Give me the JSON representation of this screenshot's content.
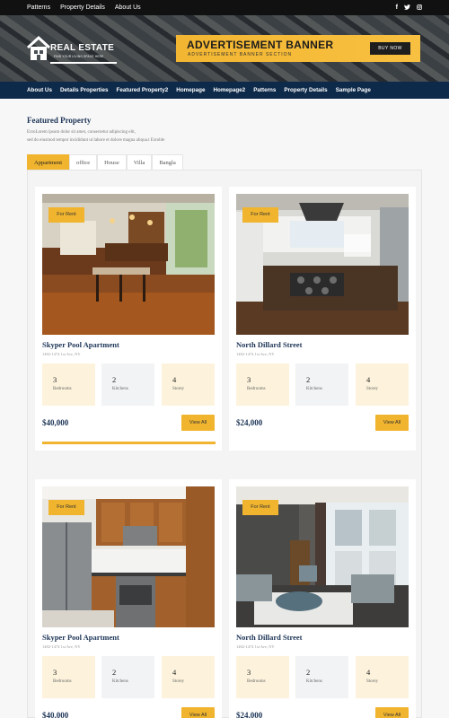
{
  "topbar": {
    "links": [
      "Patterns",
      "Property Details",
      "About Us"
    ],
    "social": [
      "f",
      "t",
      "ig"
    ]
  },
  "logo": {
    "name": "REAL ESTATE",
    "tagline": "FIND YOUR LIVING SPACE HERE"
  },
  "ad": {
    "title": "ADVERTISEMENT BANNER",
    "subtitle": "ADVERTISEMENT BANNER SECTION",
    "button": "BUY NOW"
  },
  "nav": [
    "About Us",
    "Details Properties",
    "Featured Property2",
    "Homepage",
    "Homepage2",
    "Patterns",
    "Property Details",
    "Sample Page"
  ],
  "section": {
    "title": "Featured Property",
    "desc_line1": "ExtoLorem ipsum dolor sit amet, consectetur adipiscing elit,",
    "desc_line2": "sed do eiusmod tempor incididunt ut labore et dolore magna aliqua.t Extoble"
  },
  "tabs": [
    "Appartment",
    "office",
    "House",
    "Villa",
    "Bangla"
  ],
  "active_tab": "Appartment",
  "colors": {
    "accent": "#f0b42e",
    "navy": "#0e2a4a",
    "title": "#1d3557"
  },
  "cards": [
    {
      "badge": "For Rent",
      "title": "Skyper Pool Apartment",
      "address": "1482-1474 1st Ave, NY",
      "features": [
        {
          "n": "3",
          "l": "Bedrooms"
        },
        {
          "n": "2",
          "l": "Kitchens"
        },
        {
          "n": "4",
          "l": "Storey"
        }
      ],
      "price": "$40,000",
      "button": "View All",
      "image": "kitchen-wood-photo"
    },
    {
      "badge": "For Rent",
      "title": "North Dillard Street",
      "address": "1482-1474 1st Ave, NY",
      "features": [
        {
          "n": "3",
          "l": "Bedrooms"
        },
        {
          "n": "2",
          "l": "Kitchens"
        },
        {
          "n": "4",
          "l": "Storey"
        }
      ],
      "price": "$24,000",
      "button": "View All",
      "image": "kitchen-island-photo"
    },
    {
      "badge": "For Rent",
      "title": "Skyper Pool Apartment",
      "address": "1482-1474 1st Ave, NY",
      "features": [
        {
          "n": "3",
          "l": "Bedrooms"
        },
        {
          "n": "2",
          "l": "Kitchens"
        },
        {
          "n": "4",
          "l": "Storey"
        }
      ],
      "price": "$40,000",
      "button": "View All",
      "image": "kitchen-cabinets-photo"
    },
    {
      "badge": "For Rent",
      "title": "North Dillard Street",
      "address": "1482-1474 1st Ave, NY",
      "features": [
        {
          "n": "3",
          "l": "Bedrooms"
        },
        {
          "n": "2",
          "l": "Kitchens"
        },
        {
          "n": "4",
          "l": "Storey"
        }
      ],
      "price": "$24,000",
      "button": "View All",
      "image": "living-room-photo"
    }
  ]
}
